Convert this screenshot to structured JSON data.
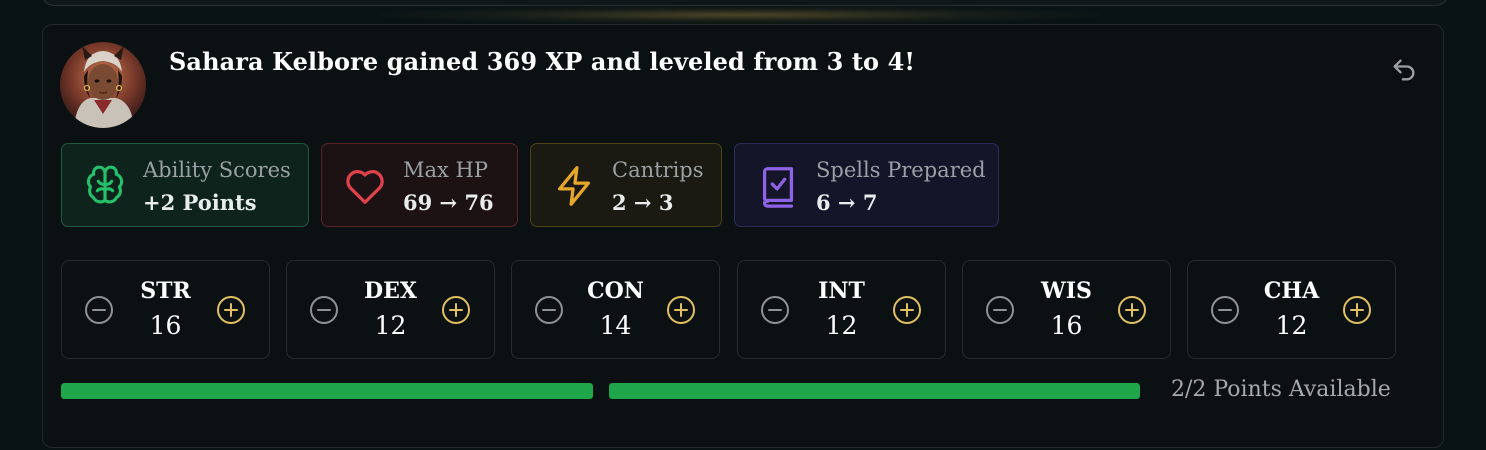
{
  "headline": "Sahara Kelbore gained 369 XP and leveled from 3 to 4!",
  "avatar_icon": "character-portrait",
  "undo_icon": "undo-icon",
  "summary": [
    {
      "key": "ability",
      "label": "Ability Scores",
      "value": "+2 Points",
      "icon": "brain-icon",
      "color": "#27c06a"
    },
    {
      "key": "hp",
      "label": "Max HP",
      "value": "69 → 76",
      "icon": "heart-icon",
      "color": "#e0424b"
    },
    {
      "key": "cantrips",
      "label": "Cantrips",
      "value": "2 → 3",
      "icon": "lightning-icon",
      "color": "#e7a72b"
    },
    {
      "key": "spells",
      "label": "Spells Prepared",
      "value": "6 → 7",
      "icon": "spellbook-icon",
      "color": "#8f63e6"
    }
  ],
  "stats": [
    {
      "abbr": "STR",
      "score": "16"
    },
    {
      "abbr": "DEX",
      "score": "12"
    },
    {
      "abbr": "CON",
      "score": "14"
    },
    {
      "abbr": "INT",
      "score": "12"
    },
    {
      "abbr": "WIS",
      "score": "16"
    },
    {
      "abbr": "CHA",
      "score": "12"
    }
  ],
  "point_bars": [
    {
      "fill": 1.0
    },
    {
      "fill": 1.0
    }
  ],
  "points_available": "2/2 Points Available",
  "colors": {
    "progress": "#1fa54a",
    "plus": "#e2c061",
    "minus": "#8e9396"
  }
}
